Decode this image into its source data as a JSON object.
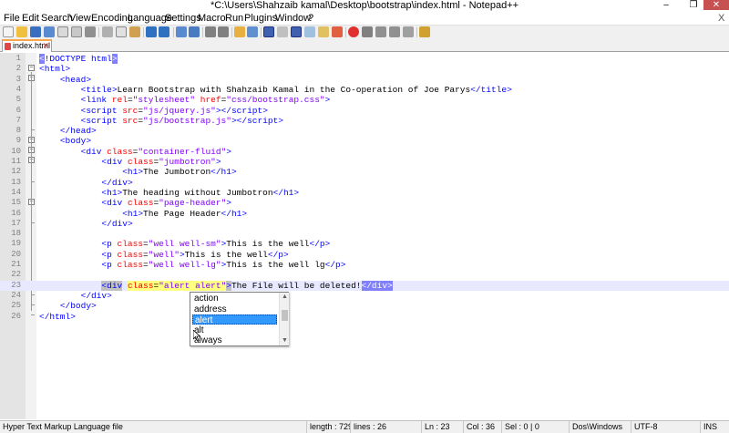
{
  "window": {
    "title": "*C:\\Users\\Shahzaib kamal\\Desktop\\bootstrap\\index.html - Notepad++",
    "min_glyph": "–",
    "max_glyph": "❐",
    "close_glyph": "✕"
  },
  "menu": [
    "File",
    "Edit",
    "Search",
    "View",
    "Encoding",
    "Language",
    "Settings",
    "Macro",
    "Run",
    "Plugins",
    "Window",
    "?"
  ],
  "menu_close_glyph": "X",
  "tab": {
    "label": "index.html",
    "close_glyph": "✕"
  },
  "lines": [
    {
      "n": "1"
    },
    {
      "n": "2"
    },
    {
      "n": "3"
    },
    {
      "n": "4"
    },
    {
      "n": "5"
    },
    {
      "n": "6"
    },
    {
      "n": "7"
    },
    {
      "n": "8"
    },
    {
      "n": "9"
    },
    {
      "n": "10"
    },
    {
      "n": "11"
    },
    {
      "n": "12"
    },
    {
      "n": "13"
    },
    {
      "n": "14"
    },
    {
      "n": "15"
    },
    {
      "n": "16"
    },
    {
      "n": "17"
    },
    {
      "n": "18"
    },
    {
      "n": "19"
    },
    {
      "n": "20"
    },
    {
      "n": "21"
    },
    {
      "n": "22"
    },
    {
      "n": "23"
    },
    {
      "n": "24"
    },
    {
      "n": "25"
    },
    {
      "n": "26"
    }
  ],
  "code": {
    "l1_doctype": "!DOCTYPE html",
    "l2": "html",
    "l3": "head",
    "l4_title_open": "title",
    "l4_text": "Learn Bootstrap with Shahzaib Kamal in the Co-operation of Joe Parys",
    "l4_title_close": "/title",
    "l5_tag": "link",
    "l5_attr1": "rel",
    "l5_val1": "\"stylesheet\"",
    "l5_attr2": "href",
    "l5_val2": "\"css/bootstrap.css\"",
    "l6_tag": "script",
    "l6_attr": "src",
    "l6_val": "\"js/jquery.js\"",
    "l6_close": "/script",
    "l7_tag": "script",
    "l7_attr": "src",
    "l7_val": "\"js/bootstrap.js\"",
    "l7_close": "/script",
    "l8": "/head",
    "l9": "body",
    "l10_tag": "div",
    "l10_attr": "class",
    "l10_val": "\"container-fluid\"",
    "l11_tag": "div",
    "l11_attr": "class",
    "l11_val": "\"jumbotron\"",
    "l12_open": "h1",
    "l12_text": "The Jumbotron",
    "l12_close": "/h1",
    "l13": "/div",
    "l14_open": "h1",
    "l14_text": "The heading without Jumbotron",
    "l14_close": "/h1",
    "l15_tag": "div",
    "l15_attr": "class",
    "l15_val": "\"page-header\"",
    "l16_open": "h1",
    "l16_text": "The Page Header",
    "l16_close": "/h1",
    "l17": "/div",
    "l19_tag": "p",
    "l19_attr": "class",
    "l19_val": "\"well well-sm\"",
    "l19_text": "This is the well",
    "l19_close": "/p",
    "l20_tag": "p",
    "l20_attr": "class",
    "l20_val": "\"well\"",
    "l20_text": "This is the well",
    "l20_close": "/p",
    "l21_tag": "p",
    "l21_attr": "class",
    "l21_val": "\"well well-lg\"",
    "l21_text": "This is the well lg",
    "l21_close": "/p",
    "l23_tag": "div",
    "l23_attr": "class",
    "l23_val": "\"alert alert\"",
    "l23_text": "The File will be deleted!",
    "l23_close": "/div",
    "l24": "/div",
    "l25": "/body",
    "l26": "/html"
  },
  "autocomplete": {
    "items": [
      "action",
      "address",
      "alert",
      "alt",
      "always"
    ],
    "selected": "alert"
  },
  "status": {
    "lang": "Hyper Text Markup Language file",
    "length": "length : 729",
    "lines": "lines : 26",
    "pos": "Ln : 23",
    "col": "Col : 36",
    "sel": "Sel : 0 | 0",
    "eol": "Dos\\Windows",
    "enc": "UTF-8",
    "mode": "INS"
  },
  "colors": {
    "tag": "#0000ff",
    "attr": "#ff0000",
    "value": "#8000ff",
    "current_line": "#e8e8ff",
    "selection": "#3399ff"
  }
}
